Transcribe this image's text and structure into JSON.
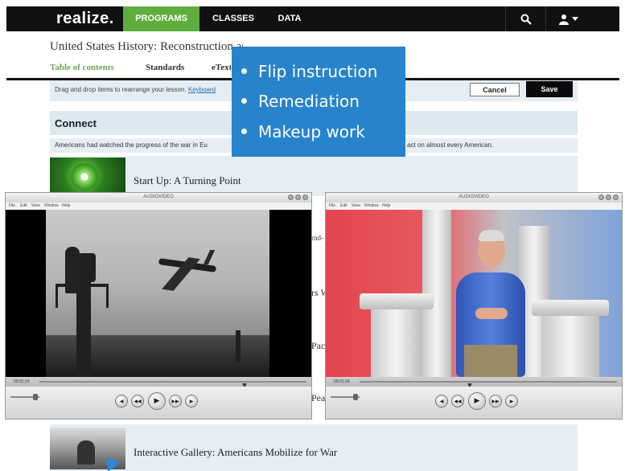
{
  "topnav": {
    "logo": "realize.",
    "items": [
      "PROGRAMS",
      "CLASSES",
      "DATA"
    ],
    "active_item": "PROGRAMS",
    "active_color": "#5fae3d",
    "icons": [
      "search-icon",
      "user-icon",
      "caret-down-icon"
    ]
  },
  "header": {
    "course_title": "United States History: Reconstruction and the Progressive Era",
    "tabs": [
      "Table of contents",
      "Standards",
      "eText"
    ]
  },
  "edit_bar": {
    "hint": "Drag and drop items to rearrange your lesson.",
    "keyboard_link": "Keyboard",
    "cancel_label": "Cancel",
    "save_label": "Save"
  },
  "lesson": {
    "section_title": "Connect",
    "section_desc": "Americans had watched the progress of the war in Eu",
    "section_desc_tail": "act on almost every American.",
    "items": [
      {
        "title": "Start Up: A Turning Point"
      },
      {
        "title": "Interactive Gallery: Americans Mobilize for War"
      }
    ],
    "partial_fragments": [
      "rnd-",
      "rs W",
      "Pacif",
      "Pea"
    ]
  },
  "callout": {
    "items": [
      "Flip instruction",
      "Remediation",
      "Makeup work"
    ],
    "background": "#2783cc"
  },
  "players": [
    {
      "title": "AUDIOVIDEO",
      "menu": [
        "File",
        "Edit",
        "View",
        "Window",
        "Help"
      ],
      "time": "00:01:24",
      "progress": 0.76
    },
    {
      "title": "AUDIOVIDEO",
      "menu": [
        "File",
        "Edit",
        "View",
        "Window",
        "Help"
      ],
      "time": "00:01:24",
      "progress": 0.42
    }
  ]
}
